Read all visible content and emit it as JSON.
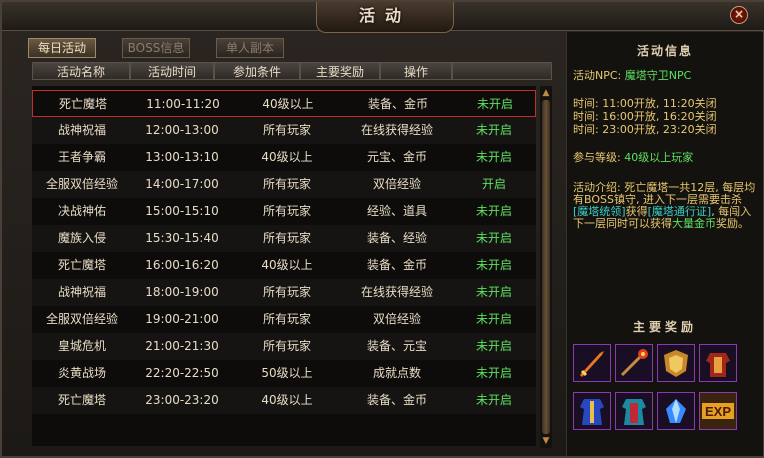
{
  "window": {
    "title": "活动",
    "close_label": "×"
  },
  "tabs": [
    {
      "label": "每日活动",
      "active": true
    },
    {
      "label": "BOSS信息",
      "active": false
    },
    {
      "label": "单人副本",
      "active": false
    }
  ],
  "columns": [
    "活动名称",
    "活动时间",
    "参加条件",
    "主要奖励",
    "操作"
  ],
  "rows": [
    {
      "name": "死亡魔塔",
      "time": "11:00-11:20",
      "cond": "40级以上",
      "reward": "装备、金币",
      "op": "未开启"
    },
    {
      "name": "战神祝福",
      "time": "12:00-13:00",
      "cond": "所有玩家",
      "reward": "在线获得经验",
      "op": "未开启"
    },
    {
      "name": "王者争霸",
      "time": "13:00-13:10",
      "cond": "40级以上",
      "reward": "元宝、金币",
      "op": "未开启"
    },
    {
      "name": "全服双倍经验",
      "time": "14:00-17:00",
      "cond": "所有玩家",
      "reward": "双倍经验",
      "op": "开启"
    },
    {
      "name": "决战神佑",
      "time": "15:00-15:10",
      "cond": "所有玩家",
      "reward": "经验、道具",
      "op": "未开启"
    },
    {
      "name": "魔族入侵",
      "time": "15:30-15:40",
      "cond": "所有玩家",
      "reward": "装备、经验",
      "op": "未开启"
    },
    {
      "name": "死亡魔塔",
      "time": "16:00-16:20",
      "cond": "40级以上",
      "reward": "装备、金币",
      "op": "未开启"
    },
    {
      "name": "战神祝福",
      "time": "18:00-19:00",
      "cond": "所有玩家",
      "reward": "在线获得经验",
      "op": "未开启"
    },
    {
      "name": "全服双倍经验",
      "time": "19:00-21:00",
      "cond": "所有玩家",
      "reward": "双倍经验",
      "op": "未开启"
    },
    {
      "name": "皇城危机",
      "time": "21:00-21:30",
      "cond": "所有玩家",
      "reward": "装备、元宝",
      "op": "未开启"
    },
    {
      "name": "炎黄战场",
      "time": "22:20-22:50",
      "cond": "50级以上",
      "reward": "成就点数",
      "op": "未开启"
    },
    {
      "name": "死亡魔塔",
      "time": "23:00-23:20",
      "cond": "40级以上",
      "reward": "装备、金币",
      "op": "未开启"
    }
  ],
  "info": {
    "title": "活动信息",
    "npc_label": "活动NPC:",
    "npc_name": "魔塔守卫NPC",
    "times": [
      "时间: 11:00开放, 11:20关闭",
      "时间: 16:00开放, 16:20关闭",
      "时间: 23:00开放, 23:20关闭"
    ],
    "level_label": "参与等级:",
    "level_value": "40级以上玩家",
    "intro_a": "活动介绍: 死亡魔塔一共12层, 每层均有BOSS镇守, 进入下一层需要击杀",
    "intro_b": "[魔塔统领]",
    "intro_c": "获得",
    "intro_d": "[魔塔通行证]",
    "intro_e": ", 每闯入下一层同时可以获得",
    "intro_f": "大量金币",
    "intro_g": "奖励。"
  },
  "rewards": {
    "title": "主要奖励",
    "items": [
      "sword-icon",
      "staff-icon",
      "shield-icon",
      "armor-red-icon",
      "robe-blue-icon",
      "robe-cyan-icon",
      "crystal-icon",
      "exp-icon"
    ],
    "exp_label": "EXP"
  }
}
